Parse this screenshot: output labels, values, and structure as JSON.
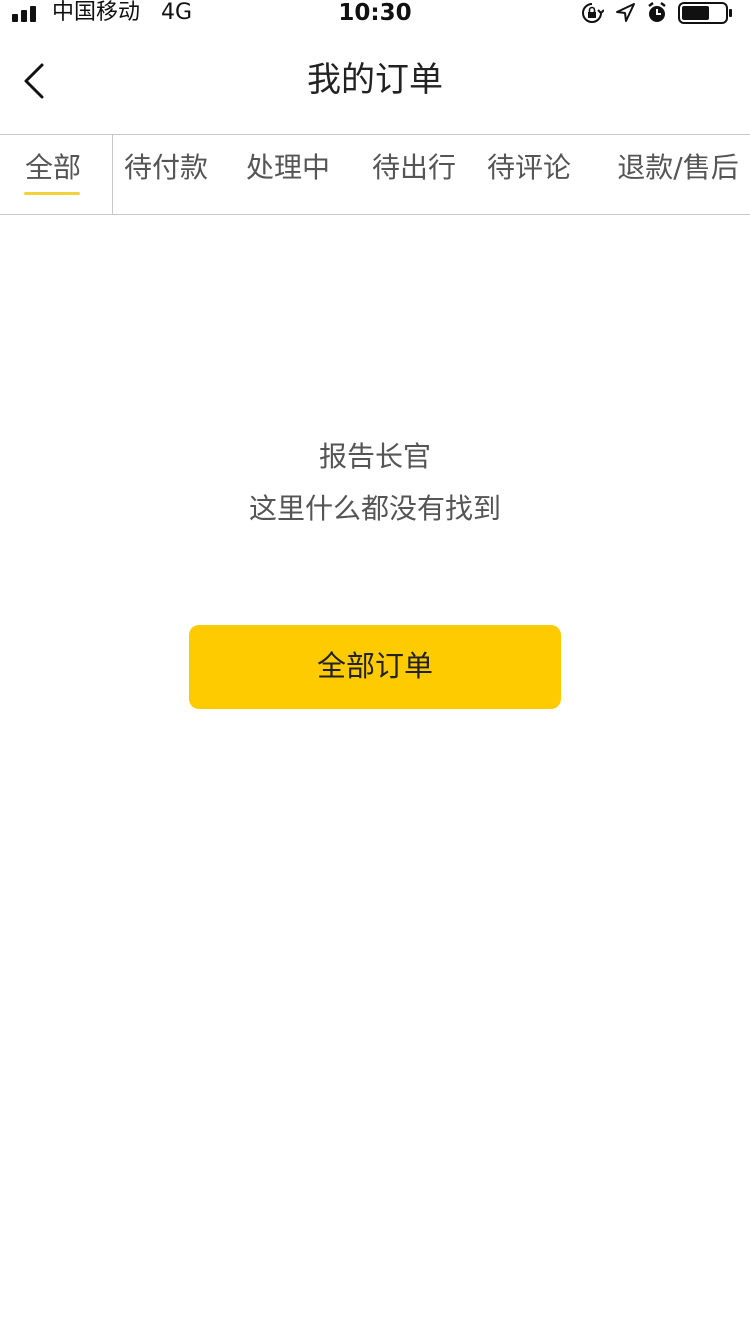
{
  "status_bar": {
    "carrier": "中国移动",
    "network": "4G",
    "time": "10:30",
    "icons": [
      "signal-icon",
      "orientation-lock-icon",
      "location-arrow-icon",
      "alarm-icon",
      "battery-icon"
    ]
  },
  "nav": {
    "title": "我的订单",
    "back_icon": "chevron-left-icon"
  },
  "tabs": {
    "items": [
      {
        "label": "全部"
      },
      {
        "label": "待付款"
      },
      {
        "label": "处理中"
      },
      {
        "label": "待出行"
      },
      {
        "label": "待评论"
      },
      {
        "label": "退款/售后"
      }
    ],
    "active_index": 0
  },
  "empty_state": {
    "line1": "报告长官",
    "line2": "这里什么都没有找到",
    "button_label": "全部订单"
  },
  "colors": {
    "accent": "#fdcb00",
    "underline": "#f5d23a",
    "text": "#333333"
  }
}
